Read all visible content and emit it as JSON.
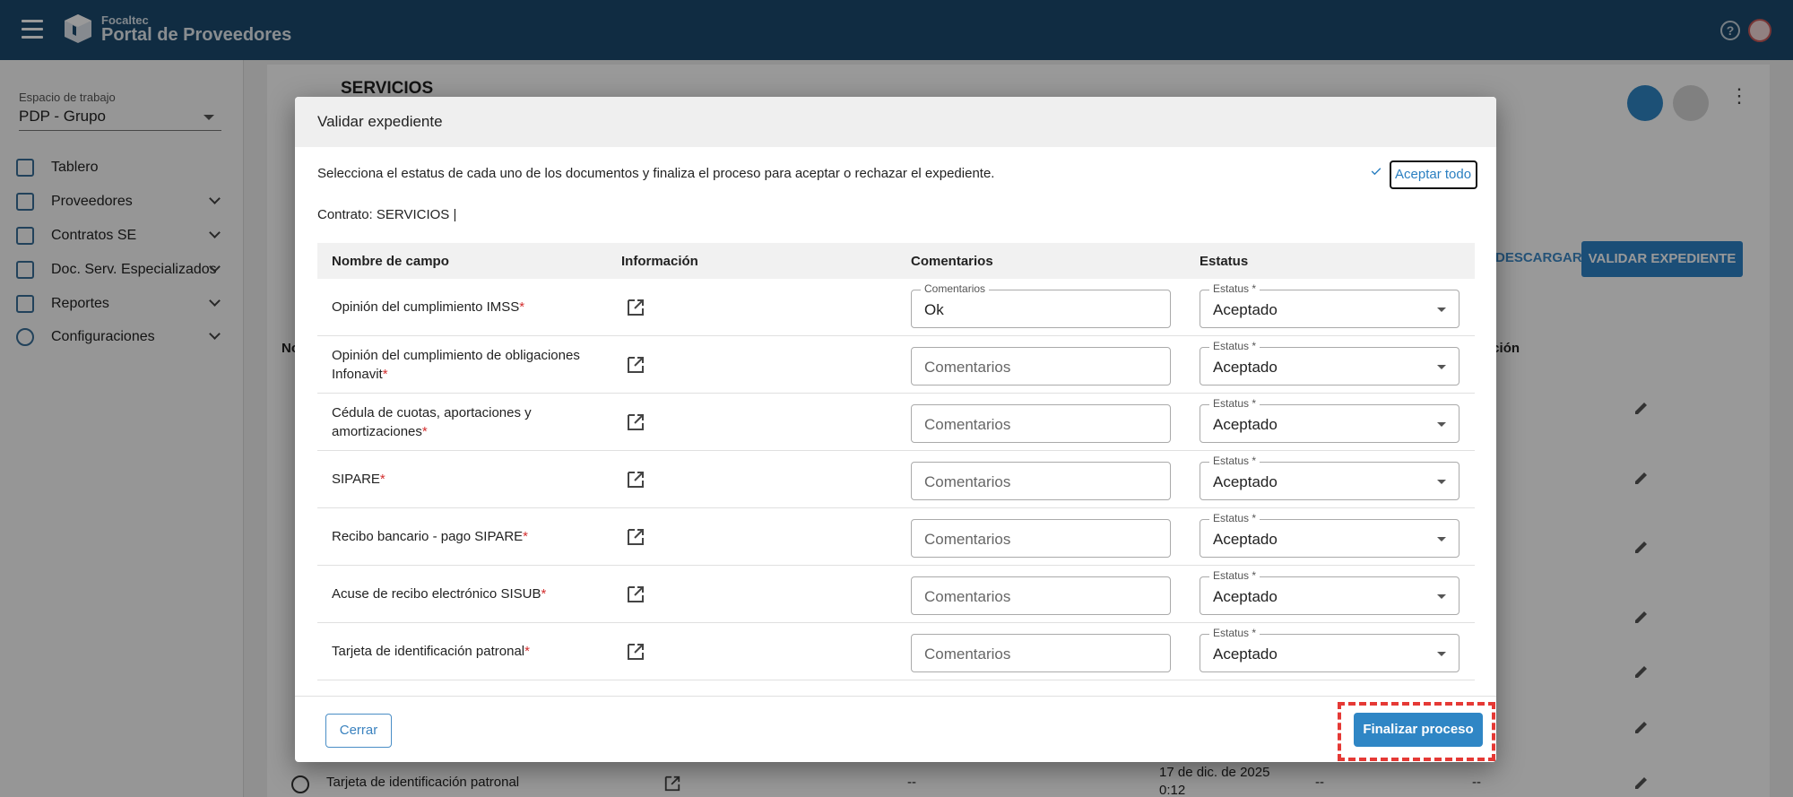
{
  "header": {
    "brand_small": "Focaltec",
    "brand_title": "Portal de Proveedores",
    "help_glyph": "?"
  },
  "sidebar": {
    "workspace_label": "Espacio de trabajo",
    "workspace_value": "PDP - Grupo",
    "items": [
      {
        "label": "Tablero",
        "icon": "dashboard-icon",
        "expandable": false
      },
      {
        "label": "Proveedores",
        "icon": "building-icon",
        "expandable": true
      },
      {
        "label": "Contratos SE",
        "icon": "book-icon",
        "expandable": true
      },
      {
        "label": "Doc. Serv. Especializados",
        "icon": "checklist-icon",
        "expandable": true
      },
      {
        "label": "Reportes",
        "icon": "report-icon",
        "expandable": true
      },
      {
        "label": "Configuraciones",
        "icon": "gear-icon",
        "expandable": true
      }
    ]
  },
  "background": {
    "page_title": "SERVICIOS",
    "descargar_label": "DESCARGAR",
    "validar_label": "VALIDAR EXPEDIENTE",
    "col_first": "No",
    "col_last": "ración",
    "last_row_name": "Tarjeta de identificación patronal",
    "last_row_date": "17 de dic. de 2025 0:12",
    "dash": "--"
  },
  "modal": {
    "title": "Validar expediente",
    "description": "Selecciona el estatus de cada uno de los documentos y finaliza el proceso para aceptar o rechazar el expediente.",
    "accept_all_label": "Aceptar todo",
    "contract_line": "Contrato: SERVICIOS |",
    "columns": [
      "Nombre de campo",
      "Información",
      "Comentarios",
      "Estatus"
    ],
    "comment_label": "Comentarios",
    "comment_placeholder": "Comentarios",
    "status_label": "Estatus *",
    "required_mark": "*",
    "rows": [
      {
        "name": "Opinión del cumplimiento IMSS",
        "comment": "Ok",
        "status": "Aceptado"
      },
      {
        "name": "Opinión del cumplimiento de obligaciones Infonavit",
        "comment": "",
        "status": "Aceptado"
      },
      {
        "name": "Cédula de cuotas, aportaciones y amortizaciones",
        "comment": "",
        "status": "Aceptado"
      },
      {
        "name": "SIPARE",
        "comment": "",
        "status": "Aceptado"
      },
      {
        "name": "Recibo bancario - pago SIPARE",
        "comment": "",
        "status": "Aceptado"
      },
      {
        "name": "Acuse de recibo electrónico SISUB",
        "comment": "",
        "status": "Aceptado"
      },
      {
        "name": "Tarjeta de identificación patronal",
        "comment": "",
        "status": "Aceptado"
      }
    ],
    "close_label": "Cerrar",
    "finish_label": "Finalizar proceso"
  },
  "colors": {
    "header_bg": "#1c4a6e",
    "accent": "#2f86c5",
    "required": "#d32f2f",
    "highlight": "#e53935"
  }
}
